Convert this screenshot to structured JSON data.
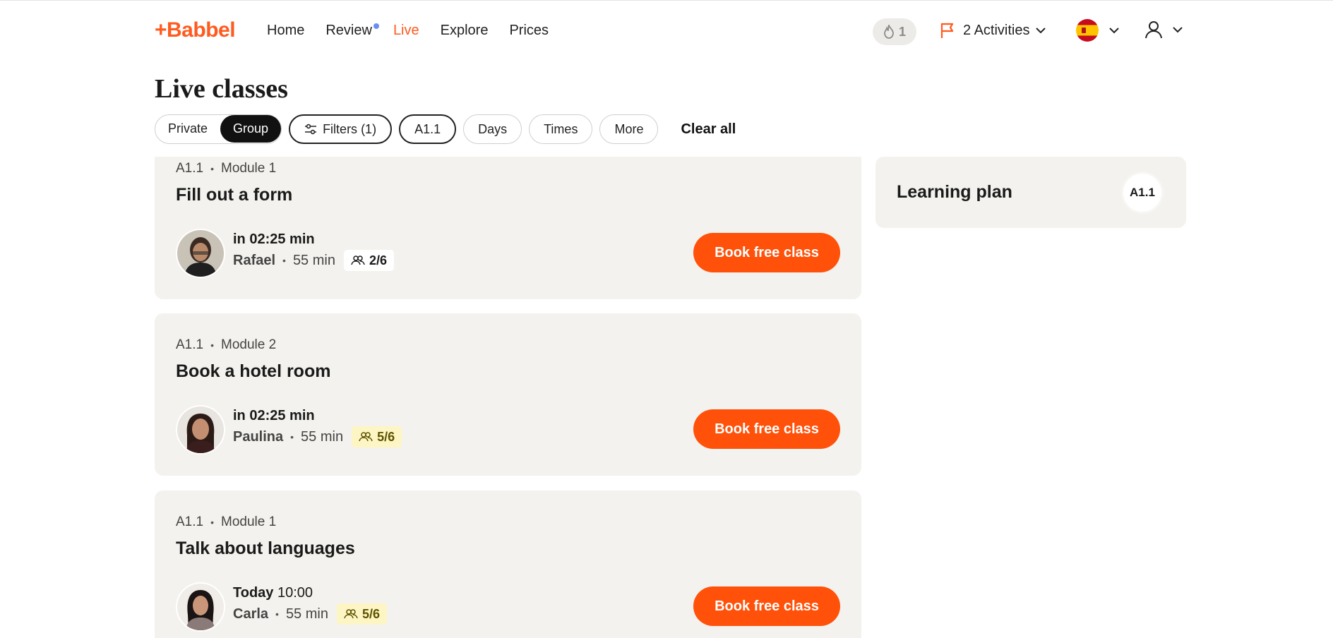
{
  "nav": {
    "logo": "+Babbel",
    "links": [
      "Home",
      "Review",
      "Live",
      "Explore",
      "Prices"
    ],
    "active_link": "Live",
    "streak_count": "1",
    "activities_label": "2 Activities"
  },
  "page": {
    "title": "Live classes"
  },
  "filters": {
    "segment": [
      "Private",
      "Group"
    ],
    "segment_selected": "Group",
    "filters_label": "Filters (1)",
    "level_label": "A1.1",
    "days_label": "Days",
    "times_label": "Times",
    "more_label": "More",
    "clear_all_label": "Clear all"
  },
  "classes": [
    {
      "level": "A1.1",
      "module": "Module 1",
      "title": "Fill out a form",
      "when_bold": "in 02:25 min",
      "when_rest": "",
      "teacher": "Rafael",
      "duration": "55 min",
      "seats": "2/6",
      "cta": "Book free class"
    },
    {
      "level": "A1.1",
      "module": "Module 2",
      "title": "Book a hotel room",
      "when_bold": "in 02:25 min",
      "when_rest": "",
      "teacher": "Paulina",
      "duration": "55 min",
      "seats": "5/6",
      "cta": "Book free class"
    },
    {
      "level": "A1.1",
      "module": "Module 1",
      "title": "Talk about languages",
      "when_bold": "Today",
      "when_rest": "10:00",
      "teacher": "Carla",
      "duration": "55 min",
      "seats": "5/6",
      "cta": "Book free class"
    }
  ],
  "learning_plan": {
    "title": "Learning plan",
    "badge": "A1.1"
  },
  "colors": {
    "brand": "#ff5a1f",
    "cta": "#ff5109",
    "card_bg": "#f3f2ee",
    "review_dot": "#6b8df2",
    "seats_warn_bg": "#fdf6c4"
  }
}
